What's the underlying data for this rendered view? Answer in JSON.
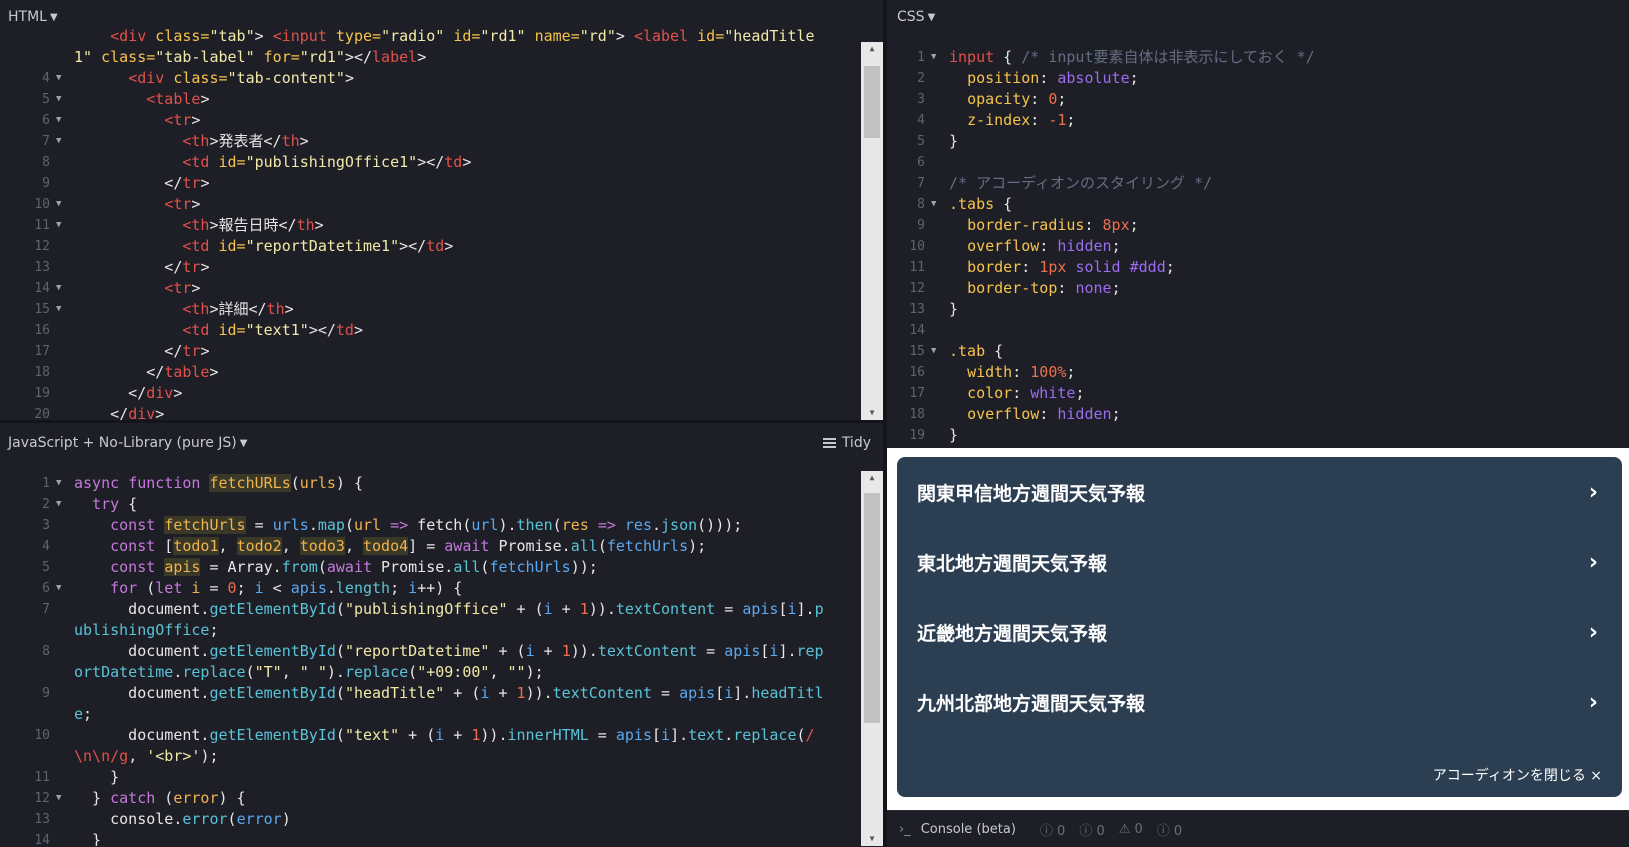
{
  "html_pane": {
    "title": "HTML",
    "lines": [
      {
        "n": "",
        "fold": false,
        "html": "    <span class=\"tg\">&lt;div</span> <span class=\"at\">class=</span><span class=\"st\">\"tab\"</span>&gt; <span class=\"tg\">&lt;input</span> <span class=\"at\">type=</span><span class=\"st\">\"radio\"</span> <span class=\"at\">id=</span><span class=\"st\">\"rd1\"</span> <span class=\"at\">name=</span><span class=\"st\">\"rd\"</span>&gt; <span class=\"tg\">&lt;label</span> <span class=\"at\">id=</span><span class=\"st\">\"headTitle</span>"
      },
      {
        "n": "",
        "fold": false,
        "html": "<span class=\"st\">1\"</span> <span class=\"at\">class=</span><span class=\"st\">\"tab-label\"</span> <span class=\"at\">for=</span><span class=\"st\">\"rd1\"</span>&gt;&lt;/<span class=\"tg\">label</span>&gt;"
      },
      {
        "n": "4",
        "fold": true,
        "html": "      <span class=\"tg\">&lt;div</span> <span class=\"at\">class=</span><span class=\"st\">\"tab-content\"</span>&gt;"
      },
      {
        "n": "5",
        "fold": true,
        "html": "        <span class=\"tg\">&lt;table</span>&gt;"
      },
      {
        "n": "6",
        "fold": true,
        "html": "          <span class=\"tg\">&lt;tr</span>&gt;"
      },
      {
        "n": "7",
        "fold": true,
        "html": "            <span class=\"tg\">&lt;th</span>&gt;発表者&lt;/<span class=\"tg\">th</span>&gt;"
      },
      {
        "n": "8",
        "fold": false,
        "html": "            <span class=\"tg\">&lt;td</span> <span class=\"at\">id=</span><span class=\"st\">\"publishingOffice1\"</span>&gt;&lt;/<span class=\"tg\">td</span>&gt;"
      },
      {
        "n": "9",
        "fold": false,
        "html": "          &lt;/<span class=\"tg\">tr</span>&gt;"
      },
      {
        "n": "10",
        "fold": true,
        "html": "          <span class=\"tg\">&lt;tr</span>&gt;"
      },
      {
        "n": "11",
        "fold": true,
        "html": "            <span class=\"tg\">&lt;th</span>&gt;報告日時&lt;/<span class=\"tg\">th</span>&gt;"
      },
      {
        "n": "12",
        "fold": false,
        "html": "            <span class=\"tg\">&lt;td</span> <span class=\"at\">id=</span><span class=\"st\">\"reportDatetime1\"</span>&gt;&lt;/<span class=\"tg\">td</span>&gt;"
      },
      {
        "n": "13",
        "fold": false,
        "html": "          &lt;/<span class=\"tg\">tr</span>&gt;"
      },
      {
        "n": "14",
        "fold": true,
        "html": "          <span class=\"tg\">&lt;tr</span>&gt;"
      },
      {
        "n": "15",
        "fold": true,
        "html": "            <span class=\"tg\">&lt;th</span>&gt;詳細&lt;/<span class=\"tg\">th</span>&gt;"
      },
      {
        "n": "16",
        "fold": false,
        "html": "            <span class=\"tg\">&lt;td</span> <span class=\"at\">id=</span><span class=\"st\">\"text1\"</span>&gt;&lt;/<span class=\"tg\">td</span>&gt;"
      },
      {
        "n": "17",
        "fold": false,
        "html": "          &lt;/<span class=\"tg\">tr</span>&gt;"
      },
      {
        "n": "18",
        "fold": false,
        "html": "        &lt;/<span class=\"tg\">table</span>&gt;"
      },
      {
        "n": "19",
        "fold": false,
        "html": "      &lt;/<span class=\"tg\">div</span>&gt;"
      },
      {
        "n": "20",
        "fold": false,
        "html": "    &lt;/<span class=\"tg\">div</span>&gt;"
      }
    ]
  },
  "css_pane": {
    "title": "CSS",
    "lines": [
      {
        "n": "1",
        "fold": true,
        "html": "<span class=\"tg\">input</span> { <span class=\"cm\">/* input要素自体は非表示にしておく */</span>"
      },
      {
        "n": "2",
        "fold": false,
        "html": "  <span class=\"at\">position</span>: <span class=\"vl\">absolute</span>;"
      },
      {
        "n": "3",
        "fold": false,
        "html": "  <span class=\"at\">opacity</span>: <span class=\"nm\">0</span>;"
      },
      {
        "n": "4",
        "fold": false,
        "html": "  <span class=\"at\">z-index</span>: <span class=\"nm\">-1</span>;"
      },
      {
        "n": "5",
        "fold": false,
        "html": "}"
      },
      {
        "n": "6",
        "fold": false,
        "html": ""
      },
      {
        "n": "7",
        "fold": false,
        "html": "<span class=\"cm\">/* アコーディオンのスタイリング */</span>"
      },
      {
        "n": "8",
        "fold": true,
        "html": "<span class=\"at\">.tabs</span> {"
      },
      {
        "n": "9",
        "fold": false,
        "html": "  <span class=\"at\">border-radius</span>: <span class=\"nm\">8px</span>;"
      },
      {
        "n": "10",
        "fold": false,
        "html": "  <span class=\"at\">overflow</span>: <span class=\"vl\">hidden</span>;"
      },
      {
        "n": "11",
        "fold": false,
        "html": "  <span class=\"at\">border</span>: <span class=\"nm\">1px</span> <span class=\"vl\">solid</span> <span class=\"vl\">#ddd</span>;"
      },
      {
        "n": "12",
        "fold": false,
        "html": "  <span class=\"at\">border-top</span>: <span class=\"vl\">none</span>;"
      },
      {
        "n": "13",
        "fold": false,
        "html": "}"
      },
      {
        "n": "14",
        "fold": false,
        "html": ""
      },
      {
        "n": "15",
        "fold": true,
        "html": "<span class=\"at\">.tab</span> {"
      },
      {
        "n": "16",
        "fold": false,
        "html": "  <span class=\"at\">width</span>: <span class=\"nm\">100%</span>;"
      },
      {
        "n": "17",
        "fold": false,
        "html": "  <span class=\"at\">color</span>: <span class=\"vl\">white</span>;"
      },
      {
        "n": "18",
        "fold": false,
        "html": "  <span class=\"at\">overflow</span>: <span class=\"vl\">hidden</span>;"
      },
      {
        "n": "19",
        "fold": false,
        "html": "}"
      }
    ]
  },
  "js_pane": {
    "title": "JavaScript + No-Library (pure JS)",
    "tidy_label": "Tidy",
    "lines": [
      {
        "n": "1",
        "fold": true,
        "html": "<span class=\"kw\">async</span> <span class=\"kw\">function</span> <span class=\"hl\">fetchURLs</span>(<span class=\"fn\">urls</span>) {"
      },
      {
        "n": "2",
        "fold": true,
        "html": "  <span class=\"kw\">try</span> {"
      },
      {
        "n": "3",
        "fold": false,
        "html": "    <span class=\"kw\">const</span> <span class=\"hl\">fetchUrls</span> = <span class=\"vr\">urls</span>.<span class=\"pr\">map</span>(<span class=\"fn\">url</span> <span class=\"kw\">=&gt;</span> fetch(<span class=\"vr\">url</span>).<span class=\"pr\">then</span>(<span class=\"fn\">res</span> <span class=\"kw\">=&gt;</span> <span class=\"vr\">res</span>.<span class=\"pr\">json</span>()));"
      },
      {
        "n": "4",
        "fold": false,
        "html": "    <span class=\"kw\">const</span> [<span class=\"hl\">todo1</span>, <span class=\"hl\">todo2</span>, <span class=\"hl\">todo3</span>, <span class=\"hl\">todo4</span>] = <span class=\"kw\">await</span> Promise.<span class=\"pr\">all</span>(<span class=\"vr\">fetchUrls</span>);"
      },
      {
        "n": "5",
        "fold": false,
        "html": "    <span class=\"kw\">const</span> <span class=\"hl\">apis</span> = Array.<span class=\"pr\">from</span>(<span class=\"kw\">await</span> Promise.<span class=\"pr\">all</span>(<span class=\"vr\">fetchUrls</span>));"
      },
      {
        "n": "6",
        "fold": true,
        "html": "    <span class=\"kw\">for</span> (<span class=\"kw\">let</span> <span class=\"fn\">i</span> = <span class=\"nm\">0</span>; <span class=\"vr\">i</span> &lt; <span class=\"vr\">apis</span>.<span class=\"pr\">length</span>; <span class=\"vr\">i</span>++) {"
      },
      {
        "n": "7",
        "fold": false,
        "html": "      document.<span class=\"pr\">getElementById</span>(<span class=\"st\">\"publishingOffice\"</span> + (<span class=\"vr\">i</span> + <span class=\"nm\">1</span>)).<span class=\"pr\">textContent</span> = <span class=\"vr\">apis</span>[<span class=\"vr\">i</span>].<span class=\"pr\">p</span>"
      },
      {
        "n": "",
        "fold": false,
        "html": "<span class=\"pr\">ublishingOffice</span>;"
      },
      {
        "n": "8",
        "fold": false,
        "html": "      document.<span class=\"pr\">getElementById</span>(<span class=\"st\">\"reportDatetime\"</span> + (<span class=\"vr\">i</span> + <span class=\"nm\">1</span>)).<span class=\"pr\">textContent</span> = <span class=\"vr\">apis</span>[<span class=\"vr\">i</span>].<span class=\"pr\">rep</span>"
      },
      {
        "n": "",
        "fold": false,
        "html": "<span class=\"pr\">ortDatetime</span>.<span class=\"pr\">replace</span>(<span class=\"st\">\"T\"</span>, <span class=\"st\">\" \"</span>).<span class=\"pr\">replace</span>(<span class=\"st\">\"+09:00\"</span>, <span class=\"st\">\"\"</span>);"
      },
      {
        "n": "9",
        "fold": false,
        "html": "      document.<span class=\"pr\">getElementById</span>(<span class=\"st\">\"headTitle\"</span> + (<span class=\"vr\">i</span> + <span class=\"nm\">1</span>)).<span class=\"pr\">textContent</span> = <span class=\"vr\">apis</span>[<span class=\"vr\">i</span>].<span class=\"pr\">headTitl</span>"
      },
      {
        "n": "",
        "fold": false,
        "html": "<span class=\"pr\">e</span>;"
      },
      {
        "n": "10",
        "fold": false,
        "html": "      document.<span class=\"pr\">getElementById</span>(<span class=\"st\">\"text\"</span> + (<span class=\"vr\">i</span> + <span class=\"nm\">1</span>)).<span class=\"pr\">innerHTML</span> = <span class=\"vr\">apis</span>[<span class=\"vr\">i</span>].<span class=\"pr\">text</span>.<span class=\"pr\">replace</span>(<span class=\"tg\">/</span>"
      },
      {
        "n": "",
        "fold": false,
        "html": "<span class=\"tg\">\\n\\n/g</span>, <span class=\"st\">'&lt;br&gt;'</span>);"
      },
      {
        "n": "11",
        "fold": false,
        "html": "    }"
      },
      {
        "n": "12",
        "fold": true,
        "html": "  } <span class=\"kw\">catch</span> (<span class=\"fn\">error</span>) {"
      },
      {
        "n": "13",
        "fold": false,
        "html": "    console.<span class=\"pr\">error</span>(<span class=\"vr\">error</span>)"
      },
      {
        "n": "14",
        "fold": false,
        "html": "  }"
      }
    ]
  },
  "result": {
    "items": [
      {
        "label": "関東甲信地方週間天気予報",
        "chevron": "›"
      },
      {
        "label": "東北地方週間天気予報",
        "chevron": "›"
      },
      {
        "label": "近畿地方週間天気予報",
        "chevron": "›"
      },
      {
        "label": "九州北部地方週間天気予報",
        "chevron": "›"
      }
    ],
    "close_label": "アコーディオンを閉じる ×",
    "bg_color": "#2c3e52"
  },
  "console": {
    "prompt": "›_",
    "label": "Console (beta)",
    "counts": [
      "ⓘ 0",
      "ⓘ 0",
      "⚠ 0",
      "ⓘ 0"
    ]
  }
}
